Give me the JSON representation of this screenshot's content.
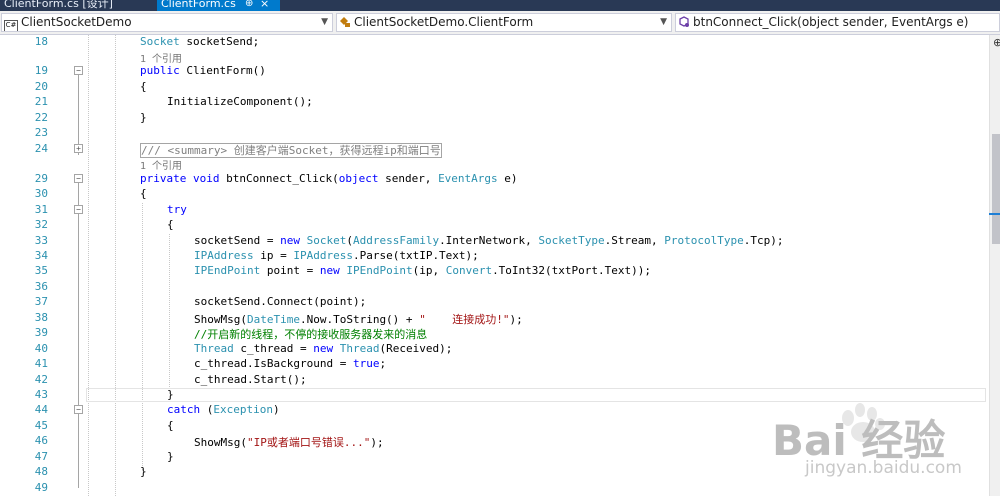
{
  "tabs": [
    {
      "label": "ClientForm.cs [设计]",
      "active": false
    },
    {
      "label": "ClientForm.cs",
      "active": true,
      "pin": "⊕",
      "close": "×"
    }
  ],
  "nav": {
    "project": "ClientSocketDemo",
    "class": "ClientSocketDemo.ClientForm",
    "member": "btnConnect_Click(object sender, EventArgs e)"
  },
  "ref_label": "1 个引用",
  "lines": [
    {
      "n": "18"
    },
    {
      "n": "19"
    },
    {
      "n": "20"
    },
    {
      "n": "21"
    },
    {
      "n": "22"
    },
    {
      "n": "23"
    },
    {
      "n": "24"
    },
    {
      "n": "29"
    },
    {
      "n": "30"
    },
    {
      "n": "31"
    },
    {
      "n": "32"
    },
    {
      "n": "33"
    },
    {
      "n": "34"
    },
    {
      "n": "35"
    },
    {
      "n": "36"
    },
    {
      "n": "37"
    },
    {
      "n": "38"
    },
    {
      "n": "39"
    },
    {
      "n": "40"
    },
    {
      "n": "41"
    },
    {
      "n": "42"
    },
    {
      "n": "43"
    },
    {
      "n": "44"
    },
    {
      "n": "45"
    },
    {
      "n": "46"
    },
    {
      "n": "47"
    },
    {
      "n": "48"
    },
    {
      "n": "49"
    }
  ],
  "code": {
    "l18_type": "Socket",
    "l18_rest": " socketSend;",
    "l19_kw": "public",
    "l19_rest": " ClientForm()",
    "l20": "{",
    "l21": "InitializeComponent();",
    "l22": "}",
    "l24_summary": "/// <summary> 创建客户端Socket，获得远程ip和端口号",
    "l29_kw1": "private",
    "l29_kw2": "void",
    "l29_name": " btnConnect_Click(",
    "l29_kw3": "object",
    "l29_mid": " sender, ",
    "l29_type": "EventArgs",
    "l29_end": " e)",
    "l30": "{",
    "l31": "try",
    "l32": "{",
    "l33_a": "socketSend = ",
    "l33_new": "new",
    "l33_t1": "Socket",
    "l33_p1": "(",
    "l33_t2": "AddressFamily",
    "l33_p2": ".InterNetwork, ",
    "l33_t3": "SocketType",
    "l33_p3": ".Stream, ",
    "l33_t4": "ProtocolType",
    "l33_p4": ".Tcp);",
    "l34_t1": "IPAddress",
    "l34_a": " ip = ",
    "l34_t2": "IPAddress",
    "l34_b": ".Parse(txtIP.Text);",
    "l35_t1": "IPEndPoint",
    "l35_a": " point = ",
    "l35_new": "new",
    "l35_t2": "IPEndPoint",
    "l35_b": "(ip, ",
    "l35_t3": "Convert",
    "l35_c": ".ToInt32(txtPort.Text));",
    "l37": "socketSend.Connect(point);",
    "l38_a": "ShowMsg(",
    "l38_t": "DateTime",
    "l38_b": ".Now.ToString() + ",
    "l38_s": "\"    连接成功!\"",
    "l38_c": ");",
    "l39": "//开启新的线程，不停的接收服务器发来的消息",
    "l40_t1": "Thread",
    "l40_a": " c_thread = ",
    "l40_new": "new",
    "l40_t2": "Thread",
    "l40_b": "(Received);",
    "l41_a": "c_thread.IsBackground = ",
    "l41_kw": "true",
    "l41_b": ";",
    "l42": "c_thread.Start();",
    "l43": "}",
    "l44_kw": "catch",
    "l44_a": " (",
    "l44_t": "Exception",
    "l44_b": ")",
    "l45": "{",
    "l46_a": "ShowMsg(",
    "l46_s": "\"IP或者端口号错误...\"",
    "l46_b": ");",
    "l47": "}",
    "l48": "}"
  },
  "watermark": {
    "main": "Bai  经验",
    "sub": "jingyan.baidu.com"
  }
}
